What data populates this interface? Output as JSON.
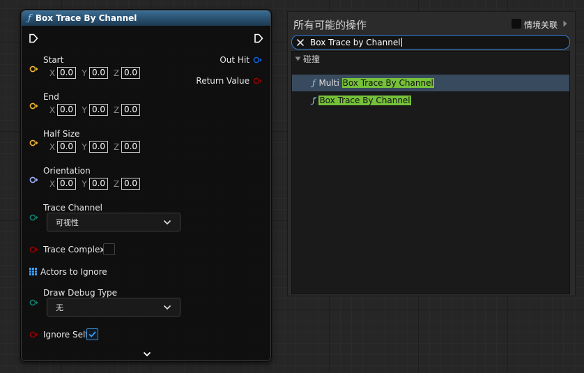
{
  "node": {
    "title": "Box Trace By Channel",
    "fx_glyph": "ƒ",
    "inputs": {
      "start": {
        "label": "Start",
        "x": "0.0",
        "y": "0.0",
        "z": "0.0"
      },
      "end": {
        "label": "End",
        "x": "0.0",
        "y": "0.0",
        "z": "0.0"
      },
      "half_size": {
        "label": "Half Size",
        "x": "0.0",
        "y": "0.0",
        "z": "0.0"
      },
      "orientation": {
        "label": "Orientation",
        "x": "0.0",
        "y": "0.0",
        "z": "0.0"
      },
      "trace_channel": {
        "label": "Trace Channel",
        "value": "可视性"
      },
      "trace_complex": {
        "label": "Trace Complex",
        "checked": false
      },
      "actors_to_ignore": {
        "label": "Actors to Ignore"
      },
      "draw_debug_type": {
        "label": "Draw Debug Type",
        "value": "无"
      },
      "ignore_self": {
        "label": "Ignore Self",
        "checked": true
      }
    },
    "axis_labels": {
      "x": "X",
      "y": "Y",
      "z": "Z"
    },
    "outputs": {
      "out_hit": {
        "label": "Out Hit"
      },
      "return_value": {
        "label": "Return Value"
      }
    }
  },
  "action_menu": {
    "title": "所有可能的操作",
    "context_sensitive_label": "情境关联",
    "context_sensitive_checked": true,
    "search_value": "Box Trace by Channel",
    "category": "碰撞",
    "items": [
      {
        "prefix": "Multi ",
        "match": "Box Trace By Channel"
      },
      {
        "prefix": "",
        "match": "Box Trace By Channel"
      }
    ]
  },
  "colors": {
    "vector_pin": "#f4b731",
    "rotator_pin": "#a0b4ff",
    "enum_pin": "#0f8272",
    "bool_pin": "#950000",
    "struct_pin": "#0a63d8",
    "array_pin": "#3aa0ff",
    "highlight": "#76c13a",
    "selection": "#384a5e",
    "search_border": "#2f7ed8"
  }
}
